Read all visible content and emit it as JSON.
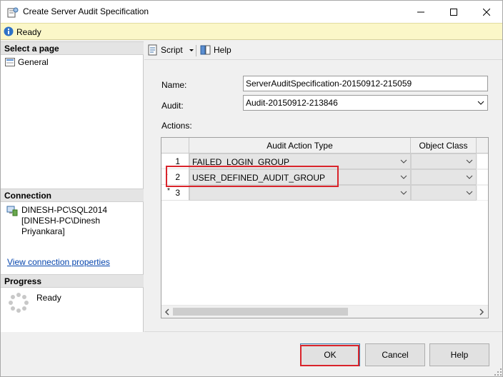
{
  "window": {
    "title": "Create Server Audit Specification"
  },
  "status": {
    "text": "Ready"
  },
  "left": {
    "select_page_header": "Select a page",
    "pages": [
      {
        "label": "General"
      }
    ],
    "connection_header": "Connection",
    "connection_lines": [
      "DINESH-PC\\SQL2014",
      "[DINESH-PC\\Dinesh",
      "Priyankara]"
    ],
    "view_connection_link": "View connection properties",
    "progress_header": "Progress",
    "progress_status": "Ready"
  },
  "toolbar": {
    "script_label": "Script",
    "help_label": "Help"
  },
  "form": {
    "name_label": "Name:",
    "name_value": "ServerAuditSpecification-20150912-215059",
    "audit_label": "Audit:",
    "audit_value": "Audit-20150912-213846",
    "actions_label": "Actions:"
  },
  "grid": {
    "columns": [
      "Audit Action Type",
      "Object Class"
    ],
    "rows": [
      {
        "num": "1",
        "marker": "",
        "action": "FAILED_LOGIN_GROUP",
        "object_class": ""
      },
      {
        "num": "2",
        "marker": "•",
        "action": "USER_DEFINED_AUDIT_GROUP",
        "object_class": ""
      },
      {
        "num": "3",
        "marker": "*",
        "action": "",
        "object_class": ""
      }
    ]
  },
  "buttons": {
    "ok": "OK",
    "cancel": "Cancel",
    "help": "Help"
  },
  "colors": {
    "highlight": "#d9242b",
    "status_bg": "#fbf7c8",
    "link": "#0645ad"
  }
}
